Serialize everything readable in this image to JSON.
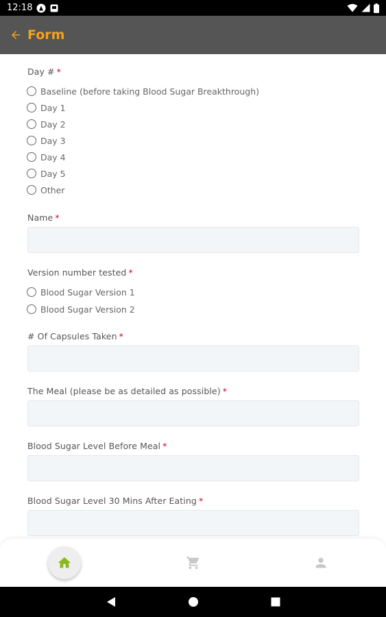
{
  "status_bar": {
    "time": "12:18"
  },
  "app_bar": {
    "title": "Form"
  },
  "form": {
    "day": {
      "label": "Day #",
      "required": "*",
      "options": [
        "Baseline (before taking Blood Sugar Breakthrough)",
        "Day 1",
        "Day 2",
        "Day 3",
        "Day 4",
        "Day 5",
        "Other"
      ]
    },
    "name": {
      "label": "Name",
      "required": "*",
      "value": ""
    },
    "version": {
      "label": "Version number tested",
      "required": "*",
      "options": [
        "Blood Sugar Version 1",
        "Blood Sugar Version 2"
      ]
    },
    "capsules": {
      "label": "# Of Capsules Taken",
      "required": "*",
      "value": ""
    },
    "meal": {
      "label": "The Meal (please be as detailed as possible)",
      "required": "*",
      "value": ""
    },
    "before_meal": {
      "label": "Blood Sugar Level Before Meal",
      "required": "*",
      "value": ""
    },
    "after_eating": {
      "label": "Blood Sugar Level 30 Mins After Eating",
      "required": "*",
      "value": ""
    }
  },
  "bottom_nav": {
    "items": [
      {
        "icon": "home-icon",
        "active": true
      },
      {
        "icon": "cart-icon",
        "active": false
      },
      {
        "icon": "person-icon",
        "active": false
      }
    ]
  },
  "colors": {
    "accent": "#f5a21c",
    "app_bar": "#555555",
    "active_icon": "#8bb81c",
    "required": "#d0021b",
    "inactive_icon": "#c8c8c8"
  }
}
